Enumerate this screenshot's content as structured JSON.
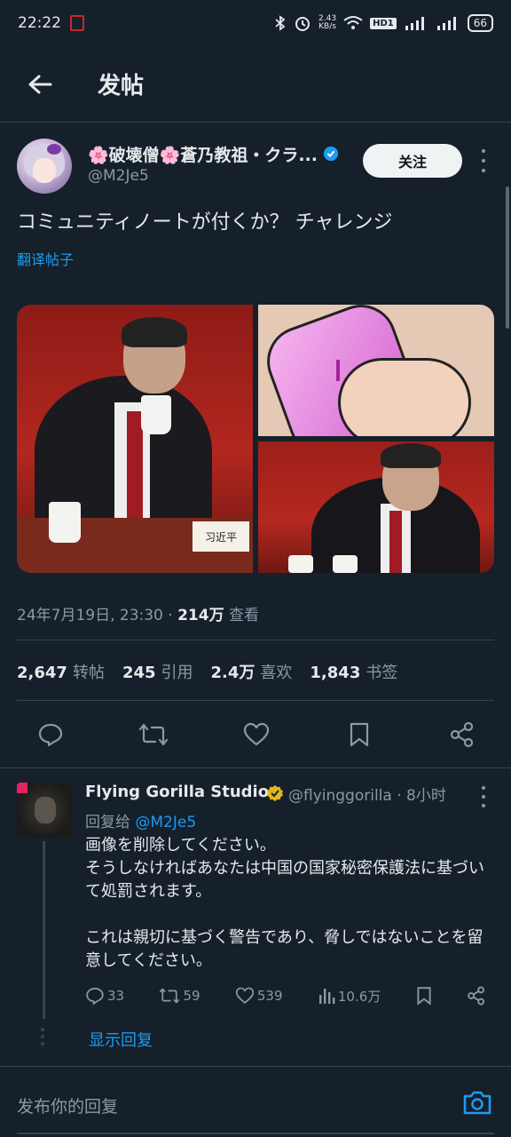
{
  "status_bar": {
    "time": "22:22",
    "net_speed_top": "2.43",
    "net_speed_unit": "KB/s",
    "hd": "HD1",
    "battery": "66"
  },
  "header": {
    "title": "发帖"
  },
  "tweet": {
    "display_name": "🌸破壊僧🌸蒼乃教祖・クラ...",
    "handle": "@M2Je5",
    "follow_label": "关注",
    "text": "コミュニティノートが付くか？ チャレンジ",
    "translate_label": "翻译帖子",
    "nameplate": "习近平",
    "timestamp": "24年7月19日, 23:30 · ",
    "views_count": "214万",
    "views_label": " 查看",
    "stats": {
      "retweets_count": "2,647",
      "retweets_label": "转帖",
      "quotes_count": "245",
      "quotes_label": "引用",
      "likes_count": "2.4万",
      "likes_label": "喜欢",
      "bookmarks_count": "1,843",
      "bookmarks_label": "书签"
    },
    "icons": [
      "reply-icon",
      "retweet-icon",
      "like-icon",
      "bookmark-icon",
      "share-icon"
    ]
  },
  "reply": {
    "display_name": "Flying Gorilla Studios",
    "handle_time": "@flyinggorilla · 8小时",
    "reply_to_prefix": "回复给 ",
    "reply_to_handle": "@M2Je5",
    "lines": [
      "画像を削除してください。",
      "そうしなければあなたは中国の国家秘密保護法に基づいて処罰されます。",
      "",
      "これは親切に基づく警告であり、脅しではないことを留意してください。"
    ],
    "replies": "33",
    "retweets": "59",
    "likes": "539",
    "views": "10.6万",
    "show_replies_label": "显示回复"
  },
  "composer": {
    "placeholder": "发布你的回复"
  },
  "colors": {
    "background": "#15202b",
    "accent": "#1d9bf0",
    "muted": "#8b98a5",
    "divider": "#38444d"
  }
}
